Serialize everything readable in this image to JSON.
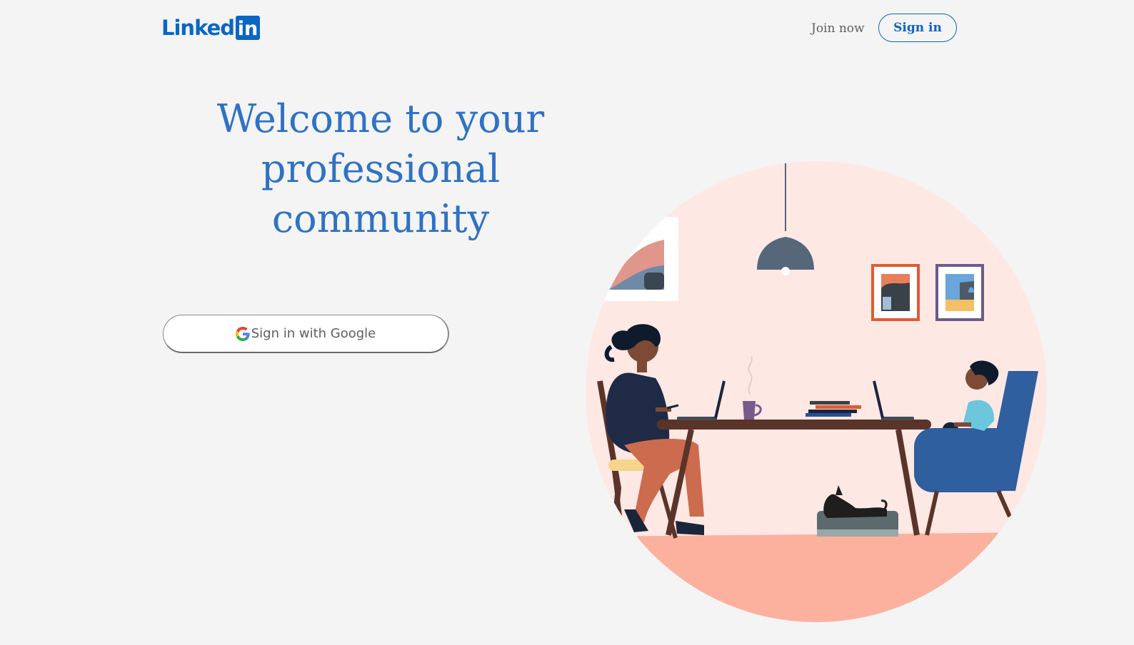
{
  "header": {
    "logo": {
      "word": "Linked",
      "box": "in"
    },
    "join_now_label": "Join now",
    "sign_in_label": "Sign in"
  },
  "hero": {
    "headline": "Welcome to your professional community",
    "google_button_label": "Sign in with Google",
    "google_icon": "google-g-icon",
    "illustration": "people-working-at-table-illustration"
  },
  "colors": {
    "brand_blue": "#0a66c2",
    "headline_blue": "#2f72c4",
    "page_background": "#f4f4f4",
    "circle_background": "#fde8e4",
    "floor": "#fcb19f"
  }
}
